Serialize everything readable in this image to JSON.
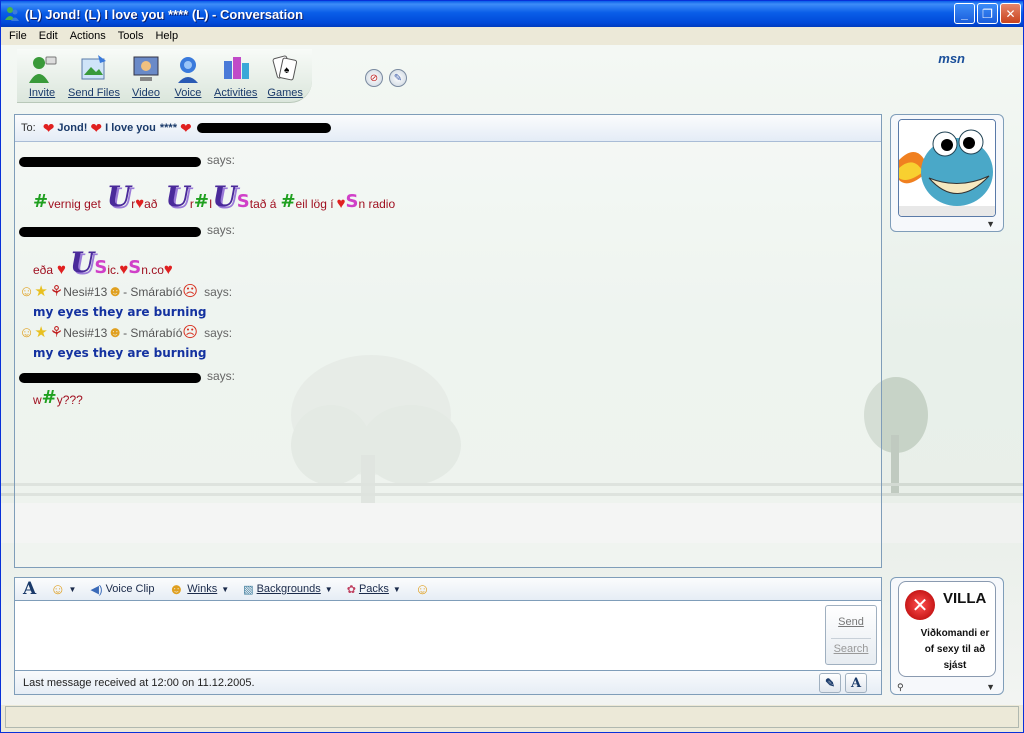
{
  "window": {
    "title": "(L) Jond! (L) I love you  **** (L) - Conversation"
  },
  "menu": [
    "File",
    "Edit",
    "Actions",
    "Tools",
    "Help"
  ],
  "toolbar": {
    "items": [
      {
        "label": "Invite",
        "icon": "invite-icon"
      },
      {
        "label": "Send Files",
        "icon": "send-files-icon"
      },
      {
        "label": "Video",
        "icon": "video-icon"
      },
      {
        "label": "Voice",
        "icon": "voice-icon"
      },
      {
        "label": "Activities",
        "icon": "activities-icon"
      },
      {
        "label": "Games",
        "icon": "games-icon"
      }
    ],
    "logo": "msn"
  },
  "to_bar": {
    "label": "To:",
    "name1": "Jond!",
    "name2": "I love you",
    "stars": "****"
  },
  "messages": {
    "says": "says:",
    "m1_a": "vernig get",
    "m1_b": "r",
    "m1_c": "að",
    "m1_d": "r",
    "m1_e": "I",
    "m1_f": "tað á",
    "m1_g": "eil lög í",
    "m1_h": "n radio",
    "m2_a": "eða",
    "m2_b": "ic.",
    "m2_c": "n.co",
    "nesi": "Nesi#13",
    "smarabio": "- Smárabíó",
    "eyes": "my eyes they are burning",
    "m5_a": "w",
    "m5_b": "y???"
  },
  "input_toolbar": {
    "voice_clip": "Voice Clip",
    "winks": "Winks",
    "backgrounds": "Backgrounds",
    "packs": "Packs"
  },
  "send": {
    "send_label": "Send",
    "search_label": "Search"
  },
  "status": {
    "text": "Last message received at 12:00 on 11.12.2005."
  },
  "ad": {
    "title": "VILLA",
    "text": "Viðkomandi er of sexy til að sjást"
  }
}
